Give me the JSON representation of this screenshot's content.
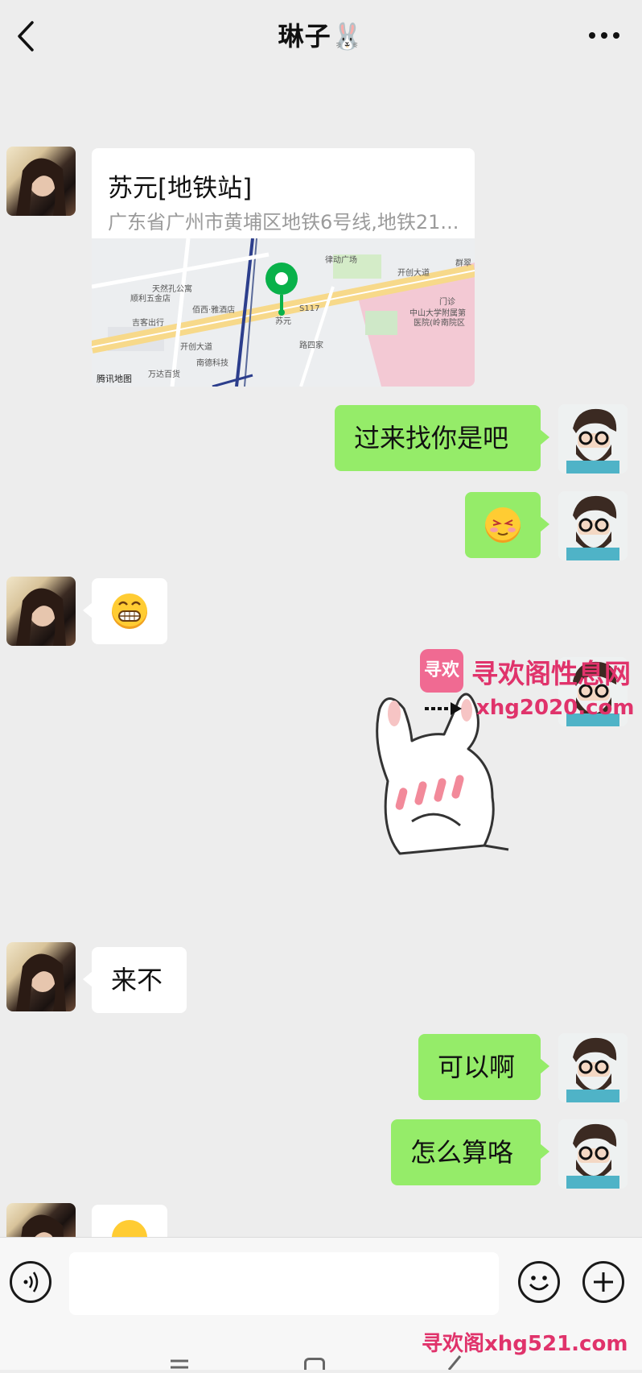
{
  "header": {
    "title": "琳子🐰"
  },
  "location": {
    "name": "苏元[地铁站]",
    "address": "广东省广州市黄埔区地铁6号线,地铁21...",
    "map_provider": "腾讯地图"
  },
  "map_labels": [
    "律动广场",
    "开创大道",
    "天然孔公寓",
    "顺利五金店",
    "佰西·雅酒店",
    "苏元",
    "S117",
    "开创大道",
    "吉客出行",
    "万达百货",
    "南德科技",
    "中山大学附属第",
    "医院(岭南院区",
    "门诊",
    "群翠",
    "路四家"
  ],
  "messages": [
    {
      "text": "过来找你是吧"
    },
    {
      "text": "来不"
    },
    {
      "text": "可以啊"
    },
    {
      "text": "怎么算咯"
    }
  ],
  "watermark": {
    "site_name": "寻欢阁性息网",
    "site_url": "xhg2020.com",
    "footer": "寻欢阁xhg521.com",
    "logo_text": "寻欢"
  },
  "icons": [
    "back-icon",
    "more-icon",
    "voice-icon",
    "emoji-icon",
    "plus-icon"
  ],
  "colors": {
    "background": "#ededed",
    "outgoing_bubble": "#95ec69",
    "incoming_bubble": "#ffffff",
    "watermark": "#e0336b"
  }
}
